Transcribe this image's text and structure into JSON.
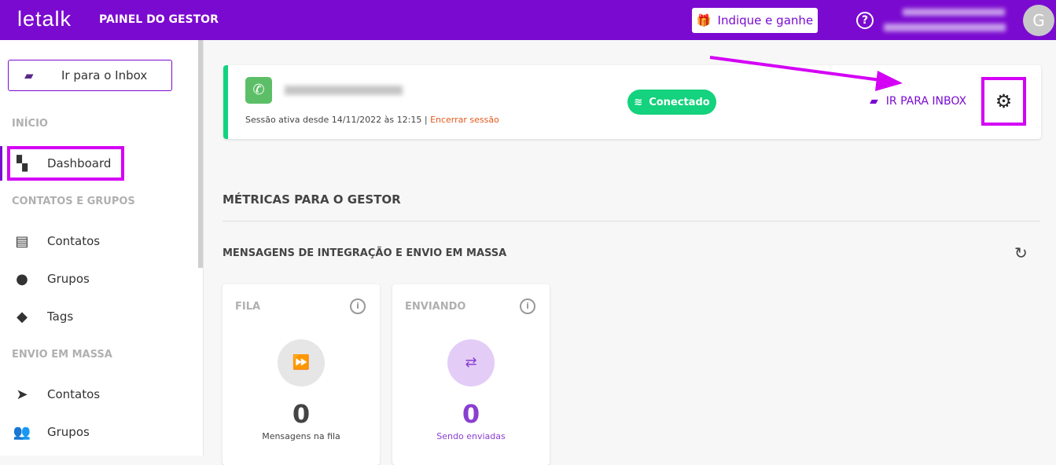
{
  "header": {
    "logo": "letalk",
    "title": "PAINEL DO GESTOR",
    "refer_label": "Indique e ganhe",
    "help": "?",
    "avatar_initial": "G"
  },
  "sidebar": {
    "inbox_button": "Ir para o Inbox",
    "sections": [
      {
        "title": "INÍCIO",
        "items": [
          {
            "label": "Dashboard",
            "icon": "dashboard-icon"
          }
        ]
      },
      {
        "title": "CONTATOS E GRUPOS",
        "items": [
          {
            "label": "Contatos",
            "icon": "contacts-icon"
          },
          {
            "label": "Grupos",
            "icon": "groups-icon"
          },
          {
            "label": "Tags",
            "icon": "tag-icon"
          }
        ]
      },
      {
        "title": "ENVIO EM MASSA",
        "items": [
          {
            "label": "Contatos",
            "icon": "send-icon"
          },
          {
            "label": "Grupos",
            "icon": "people-icon"
          }
        ]
      }
    ]
  },
  "session": {
    "since": "Sessão ativa desde 14/11/2022 às 12:15",
    "separator": "|",
    "end_label": "Encerrar sessão",
    "status": "Conectado",
    "go_inbox": "IR PARA INBOX"
  },
  "metrics": {
    "title": "MÉTRICAS PARA O GESTOR",
    "subtitle": "MENSAGENS DE INTEGRAÇÃO E ENVIO EM MASSA",
    "cards": [
      {
        "title": "FILA",
        "value": "0",
        "caption": "Mensagens na fila"
      },
      {
        "title": "ENVIANDO",
        "value": "0",
        "caption": "Sendo enviadas"
      }
    ]
  },
  "colors": {
    "brand": "#7b0ad0",
    "connected": "#14d27d",
    "highlight": "#d400f5",
    "danger": "#e25a1c"
  }
}
